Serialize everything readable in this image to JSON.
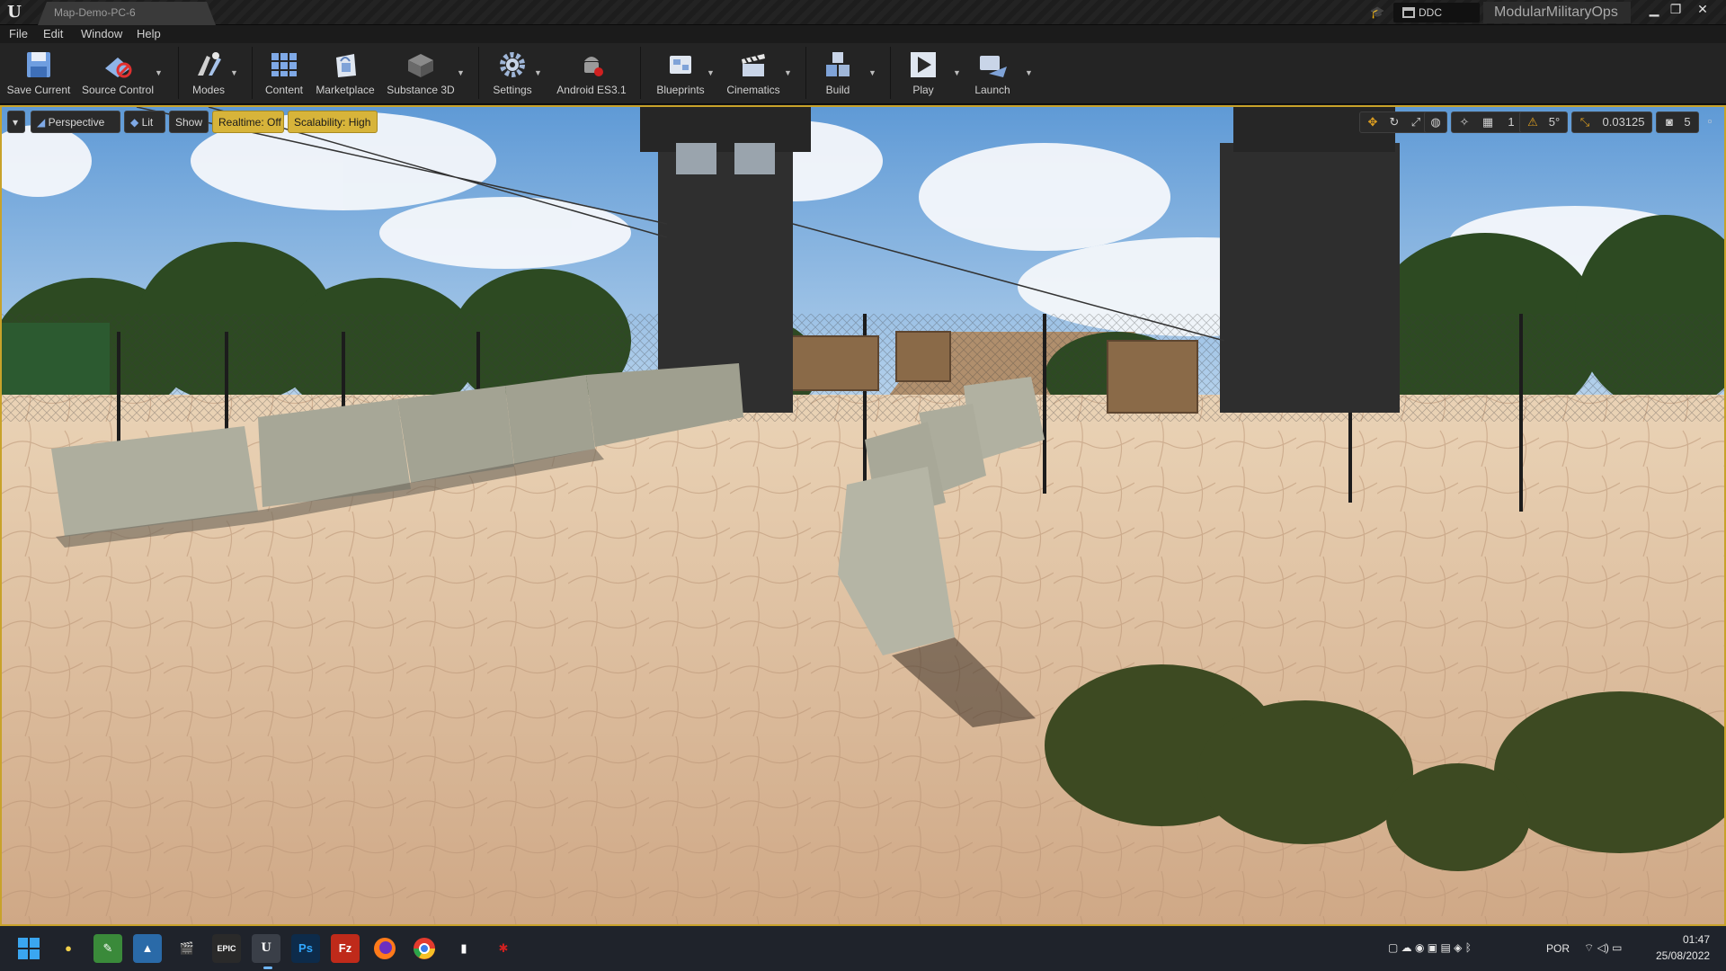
{
  "window": {
    "tab_title": "Map-Demo-PC-6",
    "ddc_label": "DDC",
    "project_name": "ModularMilitaryOps"
  },
  "menu": [
    "File",
    "Edit",
    "Window",
    "Help"
  ],
  "toolbar": {
    "save_current": "Save Current",
    "source_control": "Source Control",
    "modes": "Modes",
    "content": "Content",
    "marketplace": "Marketplace",
    "substance3d": "Substance 3D",
    "settings": "Settings",
    "android": "Android ES3.1",
    "blueprints": "Blueprints",
    "cinematics": "Cinematics",
    "build": "Build",
    "play": "Play",
    "launch": "Launch"
  },
  "viewport": {
    "perspective": "Perspective",
    "lit": "Lit",
    "show": "Show",
    "realtime": "Realtime: Off",
    "scalability": "Scalability: High",
    "grid_snap": "1",
    "rotation_snap": "5°",
    "scale_snap": "0.03125",
    "camera_speed": "5"
  },
  "taskbar": {
    "language": "POR",
    "time": "01:47",
    "date": "25/08/2022",
    "apps": [
      "start",
      "tips",
      "notepad",
      "photos",
      "clapper",
      "epic-games",
      "unreal-engine",
      "photoshop",
      "filezilla",
      "firefox",
      "chrome",
      "cooler-app",
      "red-app"
    ]
  },
  "colors": {
    "accent": "#d7b43a",
    "viewport_border": "#c8a22a",
    "sky": "#7ab0e0",
    "sand": "#d9b895"
  }
}
